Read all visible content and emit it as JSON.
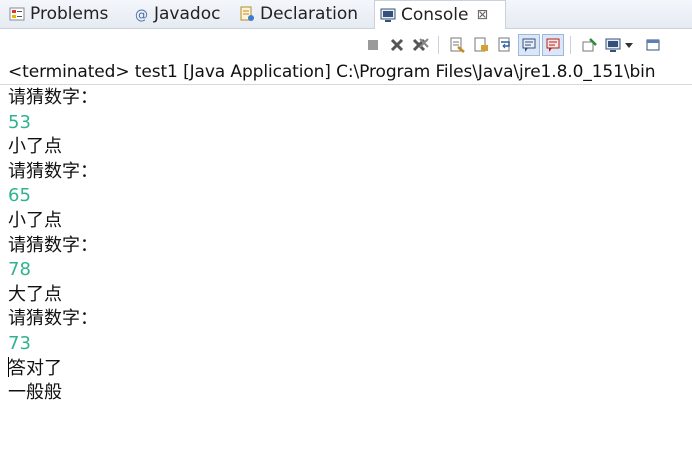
{
  "tabs": [
    {
      "label": "Problems",
      "icon": "problems-icon",
      "active": false
    },
    {
      "label": "Javadoc",
      "icon": "javadoc-icon",
      "active": false
    },
    {
      "label": "Declaration",
      "icon": "declaration-icon",
      "active": false
    },
    {
      "label": "Console",
      "icon": "console-icon",
      "active": true,
      "close": "⊠"
    }
  ],
  "toolbar": {
    "buttons": [
      "terminate-icon",
      "remove-launch-icon",
      "remove-all-terminated-icon",
      "clear-console-icon",
      "scroll-lock-icon",
      "word-wrap-icon",
      "show-on-stdout-icon",
      "show-on-stderr-icon",
      "pin-console-icon",
      "display-selected-console-icon",
      "open-console-icon"
    ]
  },
  "status": "<terminated> test1 [Java Application] C:\\Program Files\\Java\\jre1.8.0_151\\bin",
  "console": [
    {
      "text": "请猜数字：",
      "kind": "prompt"
    },
    {
      "text": "53",
      "kind": "input"
    },
    {
      "text": "小了点",
      "kind": "out"
    },
    {
      "text": "请猜数字：",
      "kind": "prompt"
    },
    {
      "text": "65",
      "kind": "input"
    },
    {
      "text": "小了点",
      "kind": "out"
    },
    {
      "text": "请猜数字：",
      "kind": "prompt"
    },
    {
      "text": "78",
      "kind": "input"
    },
    {
      "text": "大了点",
      "kind": "out"
    },
    {
      "text": "请猜数字：",
      "kind": "prompt"
    },
    {
      "text": "73",
      "kind": "input"
    },
    {
      "text": "答对了",
      "kind": "out"
    },
    {
      "text": "一般般",
      "kind": "out"
    }
  ],
  "colors": {
    "input_text": "#2fb38f",
    "output_text": "#111111"
  }
}
